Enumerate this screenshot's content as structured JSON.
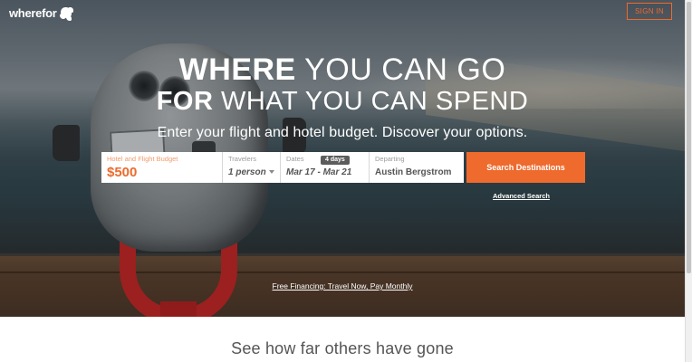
{
  "header": {
    "logo_text": "wherefor",
    "sign_in_label": "SIGN IN"
  },
  "hero": {
    "headline_line1_bold": "WHERE",
    "headline_line1_rest": " YOU CAN GO",
    "headline_line2_bold": "FOR",
    "headline_line2_rest": " WHAT YOU CAN SPEND",
    "subline": "Enter your flight and hotel budget. Discover your options."
  },
  "search": {
    "budget_label": "Hotel and Flight Budget",
    "budget_value": "$500",
    "travelers_label": "Travelers",
    "travelers_value": "1 person",
    "dates_label": "Dates",
    "dates_badge": "4 days",
    "dates_value": "Mar 17 - Mar 21",
    "departing_label": "Departing",
    "departing_value": "Austin Bergstrom",
    "button_label": "Search Destinations",
    "advanced_link": "Advanced Search"
  },
  "financing_link": "Free Financing: Travel Now, Pay Monthly",
  "lower": {
    "title": "See how far others have gone"
  },
  "colors": {
    "accent": "#ee6a2d",
    "viewer_red": "#c8231f"
  }
}
